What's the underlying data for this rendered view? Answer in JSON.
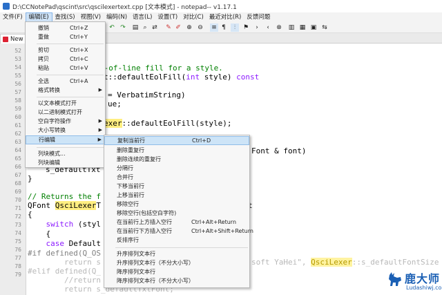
{
  "window": {
    "title": "D:\\CCNotePad\\qscint\\src\\qscilexertext.cpp [文本模式] - notepad-- v1.17.1"
  },
  "menubar": [
    "文件(F)",
    "编辑(E)",
    "查找(S)",
    "视图(V)",
    "编码(N)",
    "语言(L)",
    "设置(T)",
    "对比(C)",
    "最近对比(R)",
    "反馈问题"
  ],
  "tab": {
    "label": "New"
  },
  "line_numbers": [
    "52",
    "53",
    "54",
    "55",
    "56",
    "57",
    "58",
    "59",
    "60",
    "61",
    "62",
    "63",
    "64",
    "65",
    "66",
    "67",
    "68",
    "69",
    "70",
    "71",
    "72",
    "73",
    "74",
    "75",
    "76",
    "77",
    "78",
    "79"
  ],
  "code_fragments": {
    "l53": "d-of-line fill for a style.",
    "l54a": "t::defaultEolFill(",
    "l54b": "int",
    "l54c": " style) ",
    "l54d": "const",
    "l56": "= VerbatimString)",
    "l57": "ue;",
    "l59a": "exer",
    "l59b": "::defaultEolFill(style);",
    "l62": "Font & font)",
    "l63": "s_defaultTxt",
    "l64": "}",
    "l66a": "// Returns the f",
    "l67a": "QFont ",
    "l67b": "QsciLexer",
    "l67c": "T",
    "l67d": "t",
    "l68": "{",
    "l69a": "    switch",
    "l69b": " (styl",
    "l70": "    {",
    "l71a": "    case",
    "l71b": " Default",
    "l72a": "#if defined(Q_OS",
    "l73a": "        return s",
    "l73b": "soft YaHei\", ",
    "l73c": "QsciLexer",
    "l73d": "::s_defaultFontSize",
    "l74a": "#elif defined(Q_",
    "l75": "        //return",
    "l76": "        return s_defaultTxtFont;"
  },
  "edit_menu": {
    "items": [
      {
        "label": "撤销",
        "shortcut": "Ctrl+Z"
      },
      {
        "label": "重做",
        "shortcut": "Ctrl+Y"
      },
      {
        "label": "剪切",
        "shortcut": "Ctrl+X"
      },
      {
        "label": "拷贝",
        "shortcut": "Ctrl+C"
      },
      {
        "label": "粘贴",
        "shortcut": "Ctrl+V"
      },
      {
        "label": "全选",
        "shortcut": "Ctrl+A"
      },
      {
        "label": "格式转换",
        "shortcut": ""
      },
      {
        "label": "以文本模式打开",
        "shortcut": ""
      },
      {
        "label": "以二进制模式打开",
        "shortcut": ""
      },
      {
        "label": "空白字符操作",
        "shortcut": ""
      },
      {
        "label": "大小写转换",
        "shortcut": ""
      },
      {
        "label": "行编辑",
        "shortcut": ""
      },
      {
        "label": "列块模式...",
        "shortcut": ""
      },
      {
        "label": "列块编辑",
        "shortcut": ""
      }
    ]
  },
  "line_menu": {
    "items": [
      {
        "label": "复制当前行",
        "shortcut": "Ctrl+D"
      },
      {
        "label": "删除重复行",
        "shortcut": ""
      },
      {
        "label": "删除连续的重复行",
        "shortcut": ""
      },
      {
        "label": "分隔行",
        "shortcut": ""
      },
      {
        "label": "合并行",
        "shortcut": ""
      },
      {
        "label": "下移当前行",
        "shortcut": ""
      },
      {
        "label": "上移当前行",
        "shortcut": ""
      },
      {
        "label": "移除空行",
        "shortcut": ""
      },
      {
        "label": "移除空行(包括空白字符)",
        "shortcut": ""
      },
      {
        "label": "在当前行上方插入空行",
        "shortcut": "Ctrl+Alt+Return"
      },
      {
        "label": "在当前行下方插入空行",
        "shortcut": "Ctrl+Alt+Shift+Return"
      },
      {
        "label": "反排序行",
        "shortcut": ""
      },
      {
        "label": "升序排列文本行",
        "shortcut": ""
      },
      {
        "label": "升序排列文本行（不分大小写）",
        "shortcut": ""
      },
      {
        "label": "降序排列文本行",
        "shortcut": ""
      },
      {
        "label": "降序排列文本行（不分大小写）",
        "shortcut": ""
      }
    ]
  },
  "watermark": {
    "brand": "鹿大师",
    "site": "Ludashiwj.com"
  },
  "colors": {
    "accent": "#1a5fb4",
    "selection": "#cde4f7",
    "highlight": "#ffee80"
  }
}
